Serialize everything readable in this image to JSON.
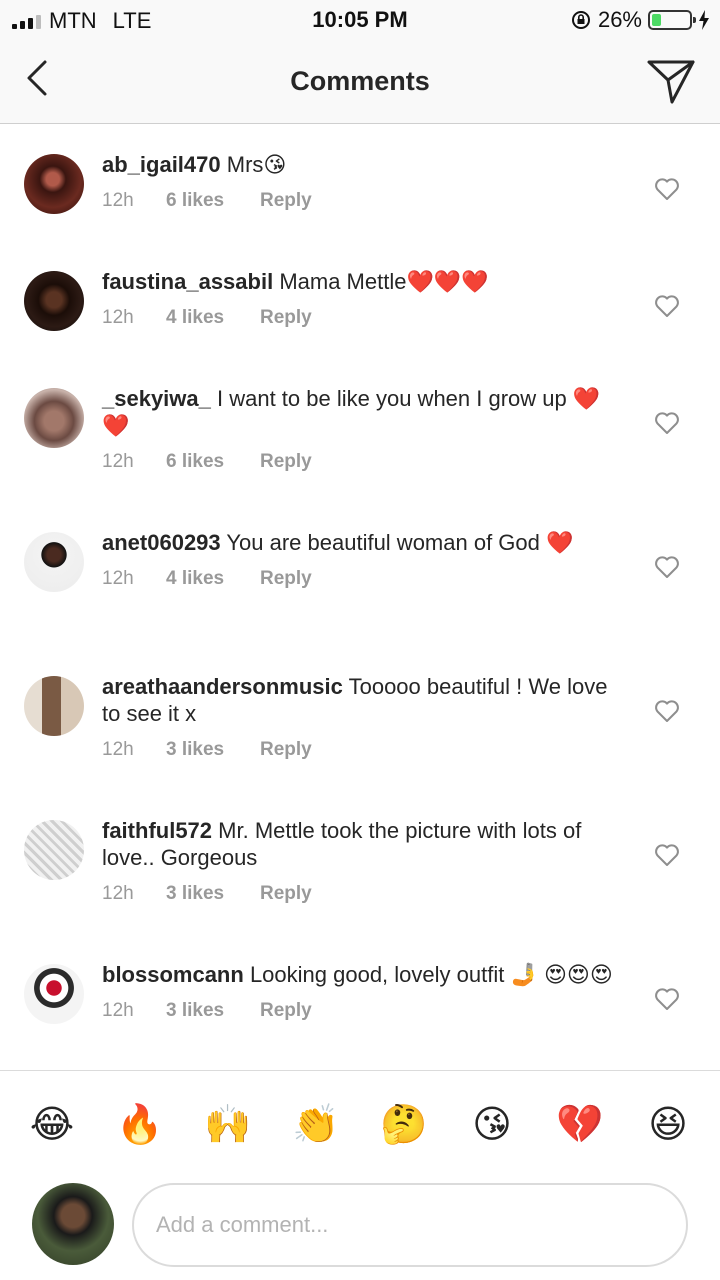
{
  "status_bar": {
    "carrier": "MTN",
    "network": "LTE",
    "time": "10:05 PM",
    "battery": "26%",
    "battery_level": 0.26
  },
  "header": {
    "title": "Comments",
    "back_icon": "chevron-left-icon",
    "send_icon": "paper-plane-icon"
  },
  "comments": [
    {
      "username": "ab_igail470",
      "text": "Mrs😘",
      "time": "12h",
      "likes": "6 likes",
      "reply": "Reply"
    },
    {
      "username": "faustina_assabil",
      "text": "Mama Mettle❤️❤️❤️",
      "time": "12h",
      "likes": "4 likes",
      "reply": "Reply"
    },
    {
      "username": "_sekyiwa_",
      "text": "I want to be like you when I grow up ❤️❤️",
      "time": "12h",
      "likes": "6 likes",
      "reply": "Reply"
    },
    {
      "username": "anet060293",
      "text": "You are beautiful woman of God ❤️",
      "time": "12h",
      "likes": "4 likes",
      "reply": "Reply"
    },
    {
      "username": "areathaandersonmusic",
      "text": "Tooooo beautiful ! We love to see it x",
      "time": "12h",
      "likes": "3 likes",
      "reply": "Reply"
    },
    {
      "username": "faithful572",
      "text": "Mr. Mettle took the picture with lots of love.. Gorgeous",
      "time": "12h",
      "likes": "3 likes",
      "reply": "Reply"
    },
    {
      "username": "blossomcann",
      "text": "Looking good, lovely outfit 🤳 😍😍😍",
      "time": "12h",
      "likes": "3 likes",
      "reply": "Reply"
    }
  ],
  "quick_emojis": [
    "😂",
    "🔥",
    "🙌",
    "👏",
    "🤔",
    "😘",
    "💔",
    "😆"
  ],
  "composer": {
    "placeholder": "Add a comment..."
  },
  "colors": {
    "text": "#262626",
    "meta": "#999999",
    "battery": "#4cd964",
    "bar_bg": "#f9f9f9"
  }
}
